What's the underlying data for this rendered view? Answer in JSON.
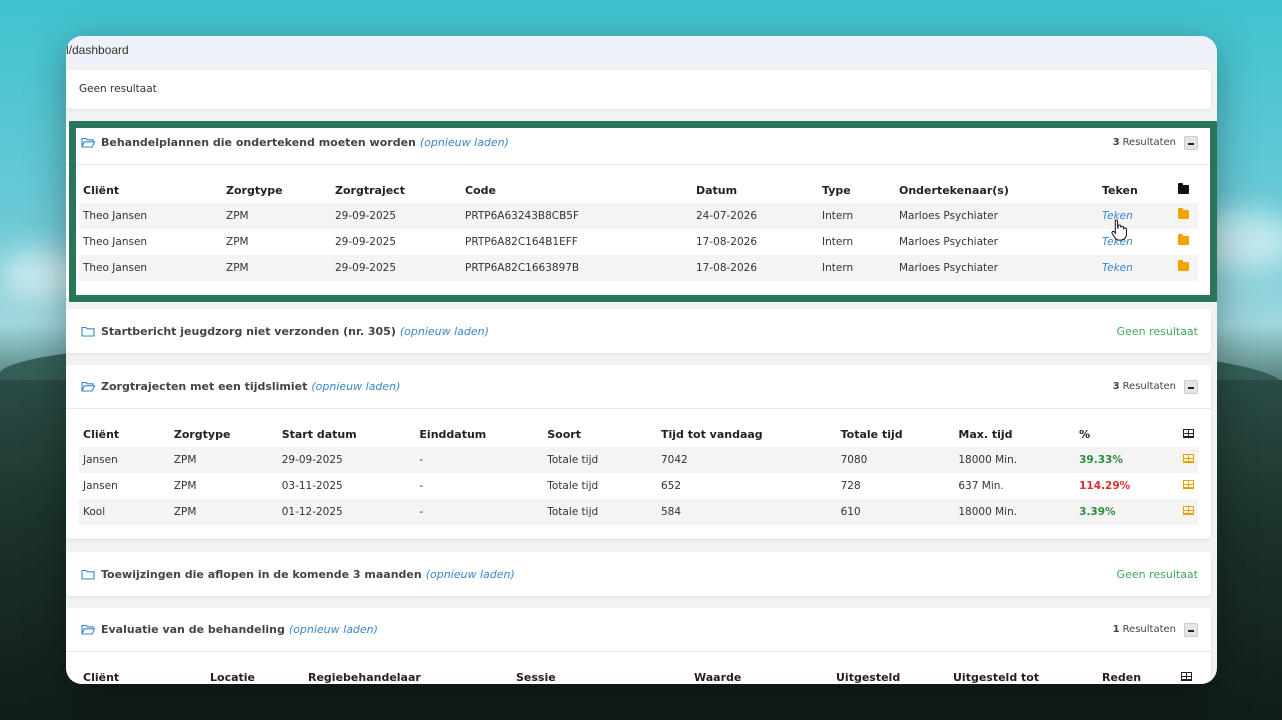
{
  "browser": {
    "url_fragment": "l/dashboard"
  },
  "top_panel": {
    "text": "Geen resultaat"
  },
  "panel1": {
    "title": "Behandelplannen die ondertekend moeten worden",
    "reload": "(opnieuw laden)",
    "count_num": "3",
    "count_label": "Resultaten",
    "headers": [
      "Cliënt",
      "Zorgtype",
      "Zorgtraject",
      "Code",
      "Datum",
      "Type",
      "Ondertekenaar(s)",
      "Teken"
    ],
    "rows": [
      [
        "Theo Jansen",
        "ZPM",
        "29-09-2025",
        "PRTP6A63243B8CB5F",
        "24-07-2026",
        "Intern",
        "Marloes Psychiater",
        "Teken"
      ],
      [
        "Theo Jansen",
        "ZPM",
        "29-09-2025",
        "PRTP6A82C164B1EFF",
        "17-08-2026",
        "Intern",
        "Marloes Psychiater",
        "Teken"
      ],
      [
        "Theo Jansen",
        "ZPM",
        "29-09-2025",
        "PRTP6A82C1663897B",
        "17-08-2026",
        "Intern",
        "Marloes Psychiater",
        "Teken"
      ]
    ]
  },
  "panel2": {
    "title": "Startbericht jeugdzorg niet verzonden (nr. 305)",
    "reload": "(opnieuw laden)",
    "status": "Geen resultaat"
  },
  "panel3": {
    "title": "Zorgtrajecten met een tijdslimiet",
    "reload": "(opnieuw laden)",
    "count_num": "3",
    "count_label": "Resultaten",
    "headers": [
      "Cliënt",
      "Zorgtype",
      "Start datum",
      "Einddatum",
      "Soort",
      "Tijd tot vandaag",
      "Totale tijd",
      "Max. tijd",
      "%"
    ],
    "rows": [
      [
        "Jansen",
        "ZPM",
        "29-09-2025",
        "-",
        "Totale tijd",
        "7042",
        "7080",
        "18000 Min.",
        "39.33%"
      ],
      [
        "Jansen",
        "ZPM",
        "03-11-2025",
        "-",
        "Totale tijd",
        "652",
        "728",
        "637 Min.",
        "114.29%"
      ],
      [
        "Kool",
        "ZPM",
        "01-12-2025",
        "-",
        "Totale tijd",
        "584",
        "610",
        "18000 Min.",
        "3.39%"
      ]
    ]
  },
  "panel4": {
    "title": "Toewijzingen die aflopen in de komende 3 maanden",
    "reload": "(opnieuw laden)",
    "status": "Geen resultaat"
  },
  "panel5": {
    "title": "Evaluatie van de behandeling",
    "reload": "(opnieuw laden)",
    "count_num": "1",
    "count_label": "Resultaten",
    "headers": [
      "Cliënt",
      "Locatie",
      "Regiebehandelaar",
      "Sessie",
      "Waarde",
      "Uitgesteld",
      "Uitgesteld tot",
      "Reden"
    ]
  },
  "colors": {
    "highlight": "#2a7557",
    "link": "#3a86c8",
    "success": "#3fa65c",
    "danger": "#d0342c"
  }
}
